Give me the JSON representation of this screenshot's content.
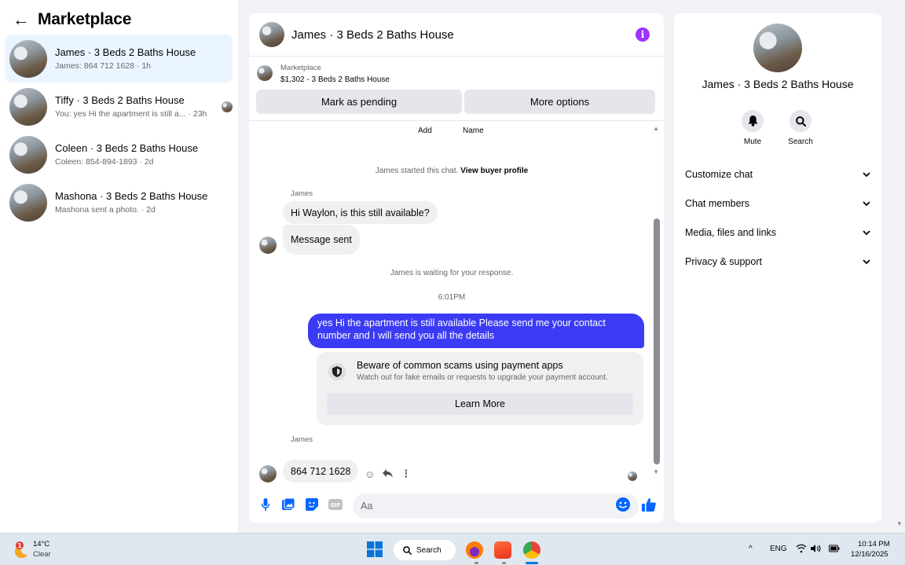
{
  "sidebar": {
    "title": "Marketplace",
    "conversations": [
      {
        "name": "James · 3 Beds 2 Baths House",
        "preview": "James: 864 712 1628 · 1h",
        "active": true
      },
      {
        "name": "Tiffy · 3 Beds 2 Baths House",
        "preview": "You: yes Hi the apartment is still a... · 23h",
        "active": false
      },
      {
        "name": "Coleen · 3 Beds 2 Baths House",
        "preview": "Coleen: 854-894-1893 · 2d",
        "active": false
      },
      {
        "name": "Mashona · 3 Beds 2 Baths House",
        "preview": "Mashona sent a photo. · 2d",
        "active": false
      }
    ]
  },
  "chat": {
    "title": "James · 3 Beds 2 Baths House",
    "listing": {
      "label": "Marketplace",
      "price_title": "$1,302 - 3 Beds 2 Baths House",
      "pending_button": "Mark as pending",
      "more_button": "More options"
    },
    "top_labels": {
      "add": "Add",
      "name": "Name"
    },
    "started": {
      "text": "James started this chat. ",
      "link": "View buyer profile"
    },
    "sender1": "James",
    "msg1": "Hi Waylon, is this still available?",
    "msg2": "Message sent",
    "waiting": "James is waiting for your response.",
    "time": "6:01PM",
    "outgoing": "yes Hi the apartment is still available Please send me your contact number and I will send you all the details",
    "warning": {
      "title": "Beware of common scams using payment apps",
      "subtitle": "Watch out for fake emails or requests to upgrade your payment account.",
      "button": "Learn More"
    },
    "sender2": "James",
    "msg3": "864 712 1628",
    "input_placeholder": "Aa",
    "accent": "#3b3bf5"
  },
  "details": {
    "name": "James · 3 Beds 2 Baths House",
    "mute_label": "Mute",
    "search_label": "Search",
    "sections": [
      "Customize chat",
      "Chat members",
      "Media, files and links",
      "Privacy & support"
    ]
  },
  "taskbar": {
    "weather_temp": "14°C",
    "weather_desc": "Clear",
    "weather_badge": "1",
    "search_label": "Search",
    "language": "ENG",
    "time": "10:14 PM",
    "date": "12/16/2025"
  }
}
